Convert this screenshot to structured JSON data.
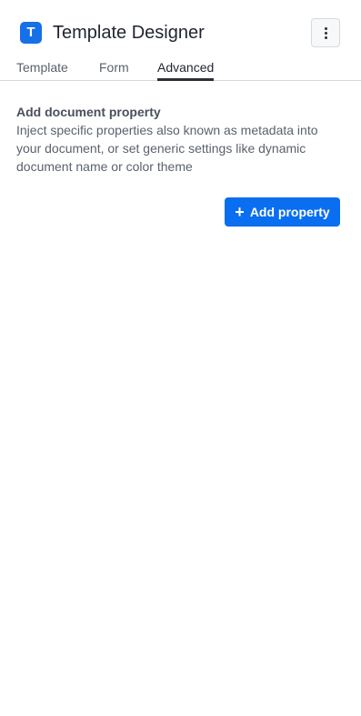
{
  "header": {
    "logo_letter": "T",
    "title": "Template Designer",
    "menu_icon": "kebab-vertical-icon"
  },
  "tabs": [
    {
      "label": "Template",
      "active": false
    },
    {
      "label": "Form",
      "active": false
    },
    {
      "label": "Advanced",
      "active": true
    }
  ],
  "advanced": {
    "title": "Add document property",
    "description": "Inject specific properties also known as metadata into your document, or set generic settings like dynamic document name or color theme",
    "add_button_label": "Add property",
    "add_button_icon": "plus-icon"
  },
  "colors": {
    "accent": "#0a6ef0",
    "logo": "#1670e8",
    "text": "#1f2430",
    "muted": "#5b616d"
  }
}
